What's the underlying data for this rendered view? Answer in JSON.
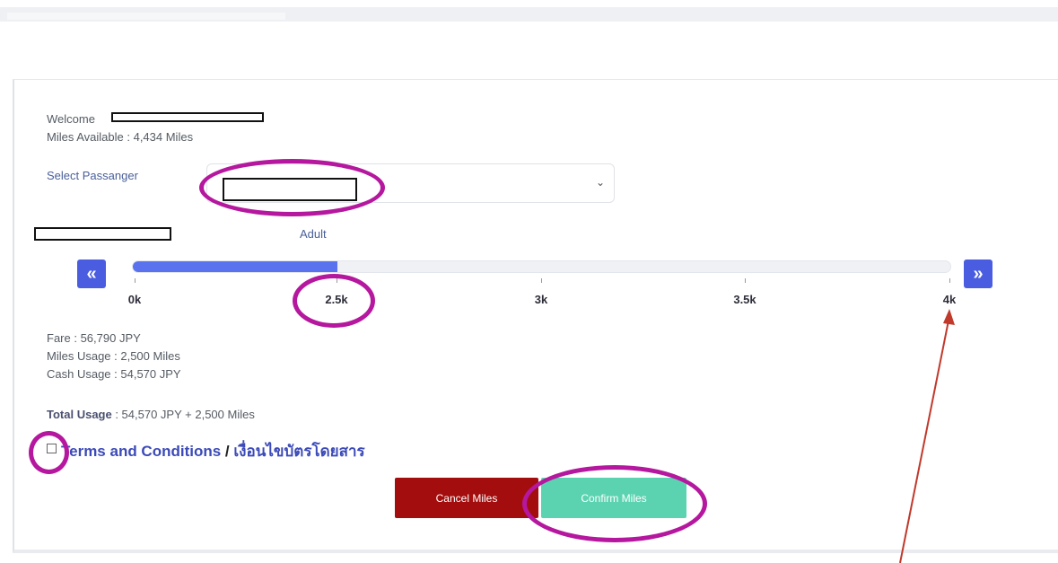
{
  "welcome": {
    "label": "Welcome"
  },
  "miles_available": "Miles Available : 4,434 Miles",
  "select_passenger": {
    "label": "Select Passanger"
  },
  "passenger_type": "Adult",
  "slider": {
    "prev_icon": "double-chevron-left-icon",
    "next_icon": "double-chevron-right-icon",
    "tick_labels": [
      "0k",
      "2.5k",
      "3k",
      "3.5k",
      "4k"
    ],
    "tick_values": [
      0,
      2500,
      3000,
      3500,
      4000
    ],
    "current_value": 2500,
    "colors": {
      "fill": "#5a72ee",
      "button": "#4a5de0"
    }
  },
  "summary": {
    "fare": "Fare : 56,790 JPY",
    "miles_usage": "Miles Usage : 2,500 Miles",
    "cash_usage": "Cash Usage : 54,570 JPY",
    "total_label": "Total Usage",
    "total_value": " : 54,570 JPY + 2,500 Miles"
  },
  "terms": {
    "link1": "Terms and Conditions",
    "separator": " / ",
    "link2": "เงื่อนไขบัตรโดยสาร"
  },
  "buttons": {
    "cancel": "Cancel Miles",
    "confirm": "Confirm Miles",
    "colors": {
      "cancel": "#a30d0d",
      "confirm": "#5cd3b0"
    }
  },
  "annotation": {
    "color": "#b5179e",
    "arrow_color": "#c0392b"
  }
}
